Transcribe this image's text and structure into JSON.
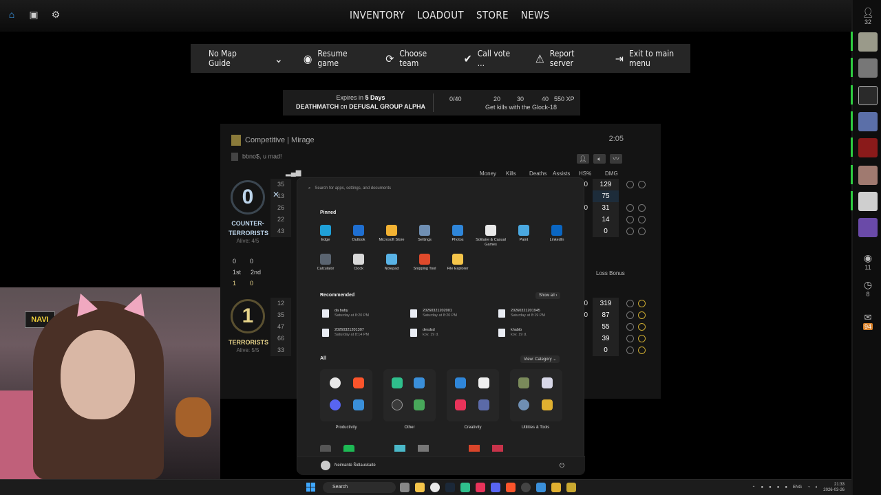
{
  "topbar": {
    "nav": [
      "INVENTORY",
      "LOADOUT",
      "STORE",
      "NEWS"
    ],
    "right_count": "32"
  },
  "menu": {
    "map_guide": "No Map Guide",
    "resume": "Resume game",
    "team": "Choose team",
    "vote": "Call vote ...",
    "report": "Report server",
    "exit": "Exit to main menu"
  },
  "mission": {
    "expires_prefix": "Expires in",
    "expires_value": "5 Days",
    "mode": "DEATHMATCH",
    "on": "on",
    "map": "DEFUSAL GROUP ALPHA",
    "progress": "0/40",
    "t20": "20",
    "t30": "30",
    "t40": "40",
    "xp": "550 XP",
    "task": "Get kills with the Glock-18"
  },
  "scoreboard": {
    "title": "Competitive | Mirage",
    "time": "2:05",
    "subtitle": "bbno$, u mad!",
    "headers": [
      "Money",
      "Kills",
      "Deaths",
      "Assists",
      "HS%",
      "DMG"
    ],
    "ct": {
      "score": "0",
      "name1": "COUNTER-",
      "name2": "TERRORISTS",
      "alive": "Alive: 4/5"
    },
    "t": {
      "score": "1",
      "name": "TERRORISTS",
      "alive": "Alive: 5/5"
    },
    "rounds": {
      "a1": "0",
      "a2": "0",
      "b1": "1st",
      "b2": "2nd",
      "c1": "1",
      "c2": "0"
    },
    "loss_bonus": "Loss Bonus",
    "ct_pings": [
      "35",
      "13",
      "26",
      "22",
      "43"
    ],
    "t_pings": [
      "12",
      "35",
      "47",
      "66",
      "33"
    ],
    "ct_dmg": [
      {
        "a": "00",
        "b": "129"
      },
      {
        "a": "0",
        "b": "75"
      },
      {
        "a": "00",
        "b": "31"
      },
      {
        "a": "0",
        "b": "14"
      },
      {
        "a": "0",
        "b": "0"
      }
    ],
    "t_dmg": [
      {
        "a": "00",
        "b": "319"
      },
      {
        "a": "00",
        "b": "87"
      },
      {
        "a": "0",
        "b": "55"
      },
      {
        "a": "0",
        "b": "39"
      },
      {
        "a": "0",
        "b": "0"
      }
    ]
  },
  "start": {
    "search_placeholder": "Search for apps, settings, and documents",
    "pinned_label": "Pinned",
    "pinned": [
      {
        "label": "Edge",
        "color": "#1fa0d8"
      },
      {
        "label": "Outlook",
        "color": "#1f6fd1"
      },
      {
        "label": "Microsoft Store",
        "color": "#f2b233"
      },
      {
        "label": "Settings",
        "color": "#6f8fb3"
      },
      {
        "label": "Photos",
        "color": "#2f86d9"
      },
      {
        "label": "Solitaire & Casual Games",
        "color": "#e9e9e9"
      },
      {
        "label": "Paint",
        "color": "#4aa8e0"
      },
      {
        "label": "LinkedIn",
        "color": "#0a66c2"
      },
      {
        "label": "Calculator",
        "color": "#5a6470"
      },
      {
        "label": "Clock",
        "color": "#d8d8d8"
      },
      {
        "label": "Notepad",
        "color": "#59b3e6"
      },
      {
        "label": "Snipping Tool",
        "color": "#e04a2b"
      },
      {
        "label": "File Explorer",
        "color": "#f5c54a"
      }
    ],
    "recommended_label": "Recommended",
    "show_all": "Show all",
    "recommended": [
      {
        "name": "da baby",
        "time": "Saturday at 8:20 PM"
      },
      {
        "name": "20260321202001",
        "time": "Saturday at 8:20 PM"
      },
      {
        "name": "20260321201945",
        "time": "Saturday at 8:19 PM"
      },
      {
        "name": "20260321201307",
        "time": "Saturday at 8:14 PM"
      },
      {
        "name": "desdsd",
        "time": "kov. 19 d."
      },
      {
        "name": "khabib",
        "time": "kov. 19 d."
      }
    ],
    "all_label": "All",
    "view": "View: Category",
    "categories": [
      "Productivity",
      "Other",
      "Creativity",
      "Utilities & Tools"
    ],
    "user": "Neimantė Šidlauskaitė"
  },
  "taskbar": {
    "search": "Search",
    "lang": "ENG",
    "time": "21:33",
    "date": "2026-03-26"
  },
  "sidebar": {
    "c1": "11",
    "c2": "8",
    "c3": "94"
  },
  "webcam": {
    "sign": "NAVI"
  }
}
